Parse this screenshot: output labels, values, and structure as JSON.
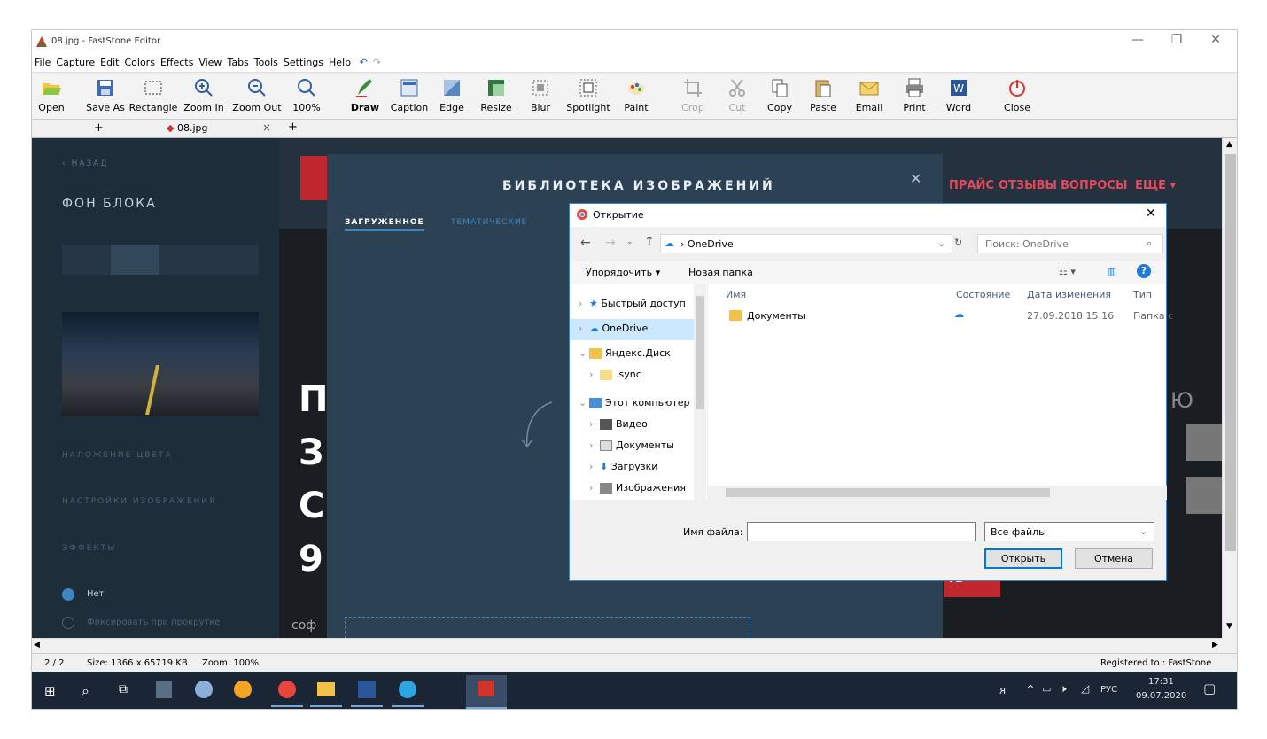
{
  "window": {
    "title": "08.jpg - FastStone Editor",
    "controls": [
      "—",
      "❐",
      "✕"
    ]
  },
  "menu": [
    "File",
    "Capture",
    "Edit",
    "Colors",
    "Effects",
    "View",
    "Tabs",
    "Tools",
    "Settings",
    "Help"
  ],
  "toolbar": {
    "open": "Open",
    "save_as": "Save As",
    "rectangle": "Rectangle",
    "zoom_in": "Zoom In",
    "zoom_out": "Zoom Out",
    "zoom_pct": "100%",
    "draw": "Draw",
    "caption": "Caption",
    "edge": "Edge",
    "resize": "Resize",
    "blur": "Blur",
    "spotlight": "Spotlight",
    "paint": "Paint",
    "crop": "Crop",
    "cut": "Cut",
    "copy": "Copy",
    "paste": "Paste",
    "email": "Email",
    "print": "Print",
    "word": "Word",
    "close": "Close"
  },
  "tabs": {
    "add1": "+",
    "file": "08.jpg",
    "close": "×",
    "add2": "+"
  },
  "site": {
    "back": "НАЗАД",
    "block_bg": "ФОН БЛОКА",
    "color_overlay": "НАЛОЖЕНИЕ ЦВЕТА",
    "image_settings": "НАСТРОЙКИ ИЗОБРАЖЕНИЯ",
    "effects": "ЭФФЕКТЫ",
    "radio_none": "Нет",
    "radio_fix": "Фиксировать при прокрутке",
    "library_title": "БИБЛИОТЕКА ИЗОБРАЖЕНИЙ",
    "tab_uploaded": "ЗАГРУЖЕННОЕ",
    "tab_thematic": "ТЕМАТИЧЕСКИЕ",
    "nav_price": "ПРАЙС",
    "nav_reviews": "ОТЗЫВЫ",
    "nav_faq": "ВОПРОСЫ",
    "nav_more": "ЕЩЕ ▾",
    "bg_letters": [
      "П",
      "З",
      "С",
      "9"
    ],
    "bg_soft": "соф",
    "bg_btn": "ТЬ",
    "bg_right": "Ю"
  },
  "open_dialog": {
    "title": "Открытие",
    "path": "OneDrive",
    "search_placeholder": "Поиск: OneDrive",
    "organize": "Упорядочить ▾",
    "new_folder": "Новая папка",
    "nav": [
      "Быстрый доступ",
      "OneDrive",
      "Яндекс.Диск",
      ".sync",
      "Этот компьютер",
      "Видео",
      "Документы",
      "Загрузки",
      "Изображения"
    ],
    "columns": [
      "Имя",
      "Состояние",
      "Дата изменения",
      "Тип"
    ],
    "rows": [
      {
        "name": "Документы",
        "date": "27.09.2018 15:16",
        "type": "Папка с"
      }
    ],
    "filename_label": "Имя файла:",
    "filename_value": "",
    "filter": "Все файлы",
    "open_btn": "Открыть",
    "cancel_btn": "Отмена"
  },
  "status": {
    "page": "2 / 2",
    "size": "Size: 1366 x 657",
    "filesize": "119 KB",
    "zoom": "Zoom: 100%",
    "registered": "Registered to : FastStone"
  },
  "taskbar": {
    "lang": "РУС",
    "time": "17:31",
    "date": "09.07.2020"
  },
  "colors": {
    "accent": "#3c86c4",
    "dark_bg": "#1c2b38",
    "red": "#c0262d"
  }
}
